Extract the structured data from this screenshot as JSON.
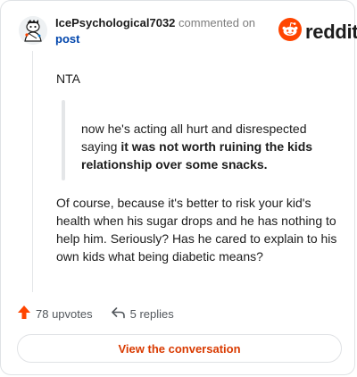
{
  "comment": {
    "author": "IcePsychological7032",
    "action_text": "commented on",
    "post_link": "post",
    "avatar_icon": "snoo-avatar-icon",
    "body": {
      "intro": "NTA",
      "quote_plain": "now he's acting all hurt and disrespected saying ",
      "quote_bold": "it was not worth ruining the kids relationship over some snacks.",
      "paragraph": "Of course, because it's better to risk your kid's health when his sugar drops and he has nothing to help him. Seriously? Has he cared to explain to his own kids what being diabetic means?"
    }
  },
  "brand": {
    "wordmark": "reddit",
    "logo_icon": "reddit-logo-icon",
    "color": "#ff4500"
  },
  "stats": {
    "upvotes_label": "78 upvotes",
    "upvote_icon": "upvote-arrow-icon",
    "upvote_color": "#ff4500",
    "replies_label": "5 replies",
    "reply_icon": "reply-icon"
  },
  "actions": {
    "view_conversation_label": "View the conversation",
    "accent": "#d93a00"
  }
}
